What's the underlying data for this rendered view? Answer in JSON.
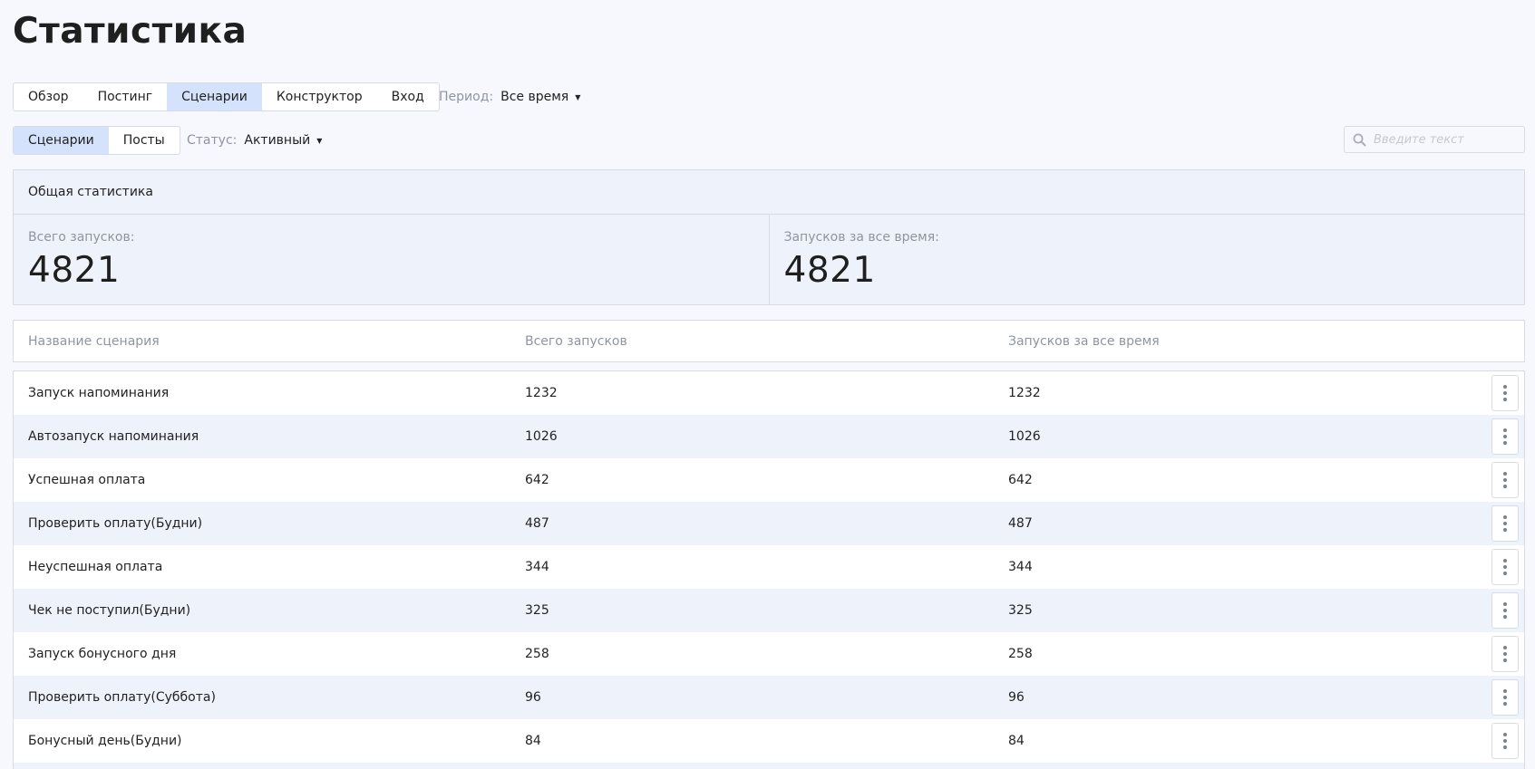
{
  "page": {
    "title": "Статистика"
  },
  "main_tabs": [
    {
      "label": "Обзор",
      "active": false
    },
    {
      "label": "Постинг",
      "active": false
    },
    {
      "label": "Сценарии",
      "active": true
    },
    {
      "label": "Конструктор",
      "active": false
    },
    {
      "label": "Вход",
      "active": false
    }
  ],
  "period": {
    "label": "Период:",
    "value": "Все время"
  },
  "sub_tabs": [
    {
      "label": "Сценарии",
      "active": true
    },
    {
      "label": "Посты",
      "active": false
    }
  ],
  "status": {
    "label": "Статус:",
    "value": "Активный"
  },
  "search": {
    "placeholder": "Введите текст",
    "icon": "search-icon"
  },
  "general_stats": {
    "title": "Общая статистика",
    "total_label": "Всего запусков:",
    "total_value": "4821",
    "alltime_label": "Запусков за все время:",
    "alltime_value": "4821"
  },
  "table": {
    "columns": [
      "Название сценария",
      "Всего запусков",
      "Запусков за все время"
    ],
    "rows": [
      {
        "name": "Запуск напоминания",
        "total": "1232",
        "alltime": "1232"
      },
      {
        "name": "Автозапуск напоминания",
        "total": "1026",
        "alltime": "1026"
      },
      {
        "name": "Успешная оплата",
        "total": "642",
        "alltime": "642"
      },
      {
        "name": "Проверить оплату(Будни)",
        "total": "487",
        "alltime": "487"
      },
      {
        "name": "Неуспешная оплата",
        "total": "344",
        "alltime": "344"
      },
      {
        "name": "Чек не поступил(Будни)",
        "total": "325",
        "alltime": "325"
      },
      {
        "name": "Запуск бонусного дня",
        "total": "258",
        "alltime": "258"
      },
      {
        "name": "Проверить оплату(Суббота)",
        "total": "96",
        "alltime": "96"
      },
      {
        "name": "Бонусный день(Будни)",
        "total": "84",
        "alltime": "84"
      }
    ]
  },
  "colors": {
    "active_tab": "#d4e2fb",
    "row_alt": "#eef3fb",
    "background": "#f6f8fd",
    "muted_text": "#8f95a0"
  }
}
